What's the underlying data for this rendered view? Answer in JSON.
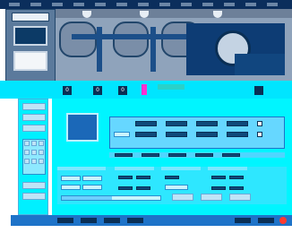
{
  "header": {
    "menu_items": [
      "",
      "",
      "",
      "",
      "",
      "",
      "",
      "",
      "",
      "",
      "",
      "",
      "",
      "",
      ""
    ]
  },
  "left_panel": {
    "logo_text": "",
    "numeric_display": ""
  },
  "process": {
    "station_labels": [
      "0",
      "0",
      "0"
    ],
    "right_label": "",
    "mid_caption": ""
  },
  "control": {
    "title": "",
    "param_rows": [
      {
        "label": "",
        "values": [
          "",
          "",
          "",
          ""
        ]
      },
      {
        "label": "",
        "values": [
          "",
          "",
          "",
          ""
        ]
      },
      {
        "label": "",
        "values": [
          "",
          "",
          "",
          ""
        ]
      }
    ],
    "section_titles": [
      "",
      "",
      "",
      ""
    ],
    "bottom_inputs": [
      "",
      "",
      "",
      "",
      "",
      "",
      "",
      "",
      "",
      "",
      "",
      ""
    ],
    "progress_label": ""
  },
  "footer": {
    "status": "",
    "items": [
      "",
      "",
      "",
      "",
      "",
      ""
    ]
  },
  "colors": {
    "accent": "#1e73c8",
    "panel": "#00e5ff",
    "dark_blue": "#0a2f55",
    "magenta": "#ff2fd1",
    "alarm": "#ff3b30"
  }
}
